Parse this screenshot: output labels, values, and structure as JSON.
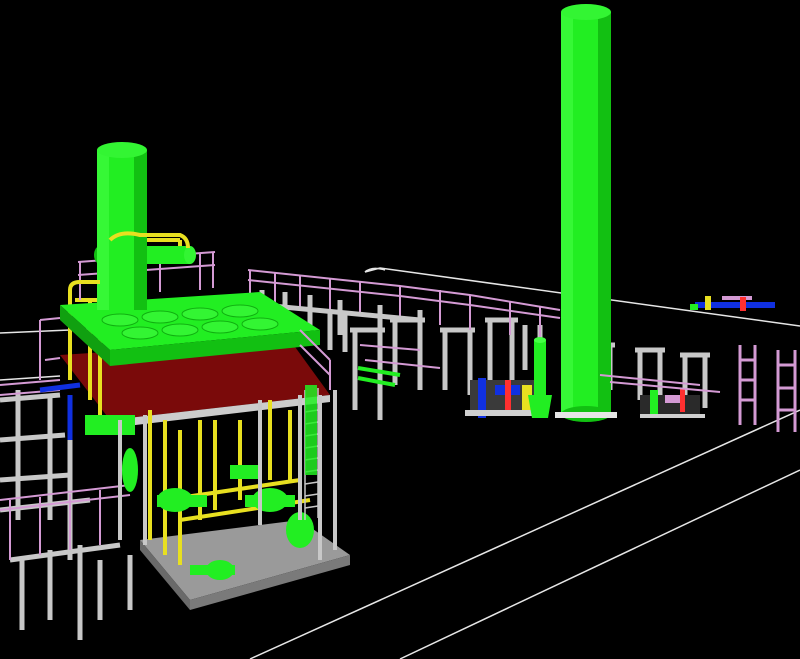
{
  "viewport": {
    "background": "#000000"
  },
  "colors": {
    "vessel_green": "#22ee22",
    "vessel_green_dark": "#10b010",
    "steel_grey": "#c8c8c8",
    "steel_grey_dark": "#8a8a8a",
    "handrail_pink": "#d49ad4",
    "pipe_yellow": "#e8e020",
    "pipe_blue": "#1030e0",
    "deck_red": "#8a1010",
    "outline_white": "#e6e6e6"
  },
  "model": {
    "icons": {
      "plant": "process-plant-icon",
      "stack": "stack-icon",
      "pipe_rack": "pipe-rack-icon",
      "equipment": "equipment-icon"
    }
  }
}
